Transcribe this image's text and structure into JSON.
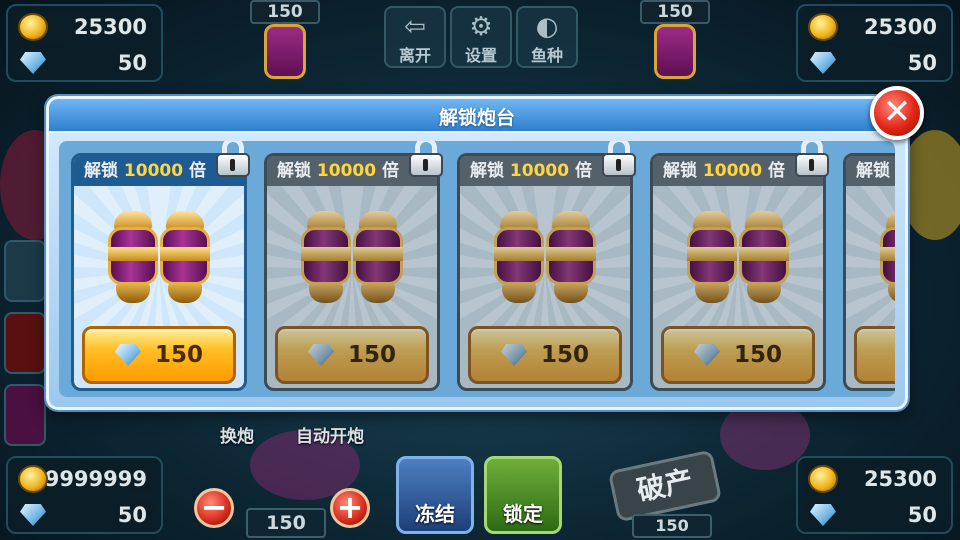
{
  "players": {
    "top_left": {
      "coins": "25300",
      "gems": "50"
    },
    "top_right": {
      "coins": "25300",
      "gems": "50"
    },
    "bottom_left": {
      "coins": "9999999",
      "gems": "50"
    },
    "bottom_right": {
      "coins": "25300",
      "gems": "50"
    }
  },
  "top_cannons": {
    "left_bet": "150",
    "right_bet": "150"
  },
  "menu": {
    "leave": "离开",
    "settings": "设置",
    "fish_types": "鱼种"
  },
  "dialog": {
    "title": "解锁炮台",
    "cards": [
      {
        "lock_prefix": "解锁",
        "multiplier": "10000",
        "lock_suffix": "倍",
        "price": "150"
      },
      {
        "lock_prefix": "解锁",
        "multiplier": "10000",
        "lock_suffix": "倍",
        "price": "150"
      },
      {
        "lock_prefix": "解锁",
        "multiplier": "10000",
        "lock_suffix": "倍",
        "price": "150"
      },
      {
        "lock_prefix": "解锁",
        "multiplier": "10000",
        "lock_suffix": "倍",
        "price": "150"
      },
      {
        "lock_prefix": "解锁",
        "multiplier": "",
        "lock_suffix": "",
        "price": ""
      }
    ]
  },
  "behind": {
    "switch_cannon": "换炮",
    "auto_fire": "自动开炮"
  },
  "bottom": {
    "bet": "150",
    "freeze": "冻结",
    "lock_target": "锁定",
    "bankrupt": "破产",
    "other_bet": "150",
    "minus": "−",
    "plus": "+"
  }
}
